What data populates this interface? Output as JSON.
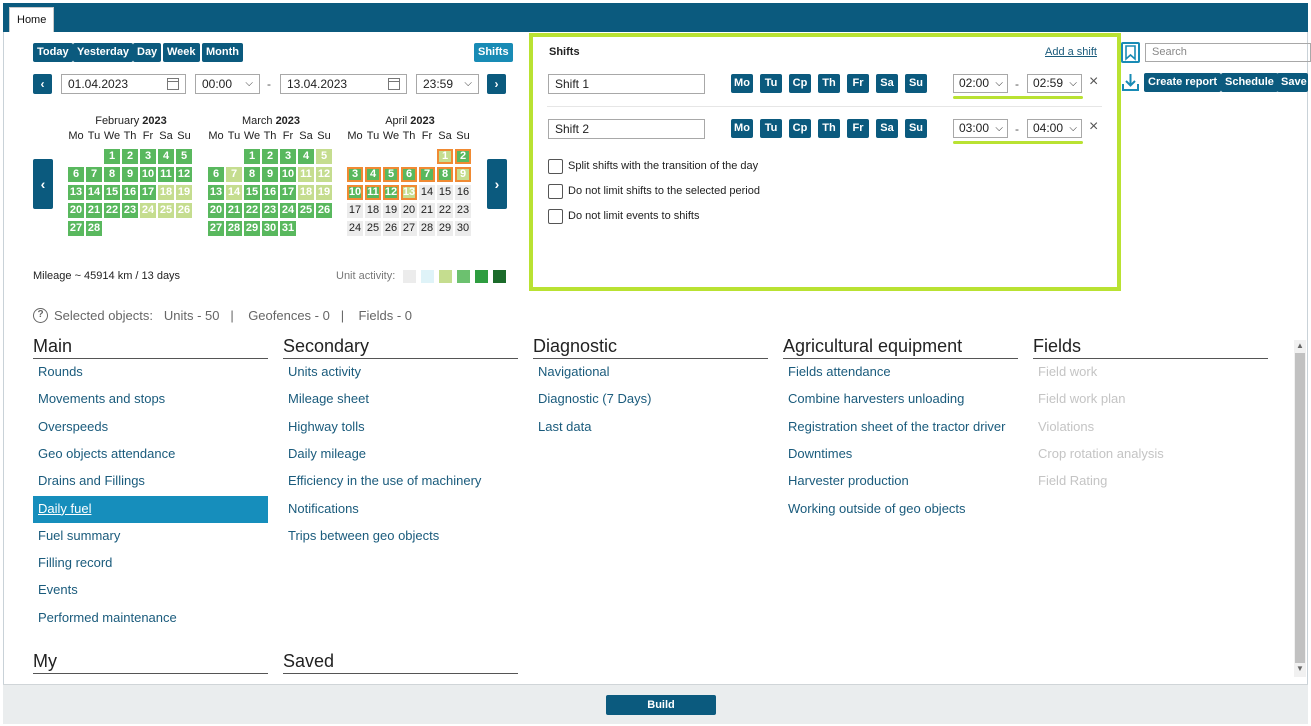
{
  "tabs": {
    "home": "Home"
  },
  "period_buttons": {
    "today": "Today",
    "yesterday": "Yesterday",
    "day": "Day",
    "week": "Week",
    "month": "Month",
    "shifts": "Shifts"
  },
  "date_range": {
    "from_date": "01.04.2023",
    "from_time": "00:00",
    "dash": "-",
    "to_date": "13.04.2023",
    "to_time": "23:59"
  },
  "calendar": {
    "weekdays": [
      "Mo",
      "Tu",
      "We",
      "Th",
      "Fr",
      "Sa",
      "Su"
    ],
    "months": [
      {
        "name": "February",
        "year": "2023"
      },
      {
        "name": "March",
        "year": "2023"
      },
      {
        "name": "April",
        "year": "2023"
      }
    ]
  },
  "stats": {
    "mileage": "Mileage ~ 45914 km / 13 days",
    "unit_activity": "Unit activity:"
  },
  "activity_colors": [
    "#ececec",
    "#dff3f8",
    "#c5dd8f",
    "#6cc16f",
    "#2e9d40",
    "#1b6b2a"
  ],
  "selected_objects": {
    "label": "Selected objects:",
    "units": "Units - 50",
    "geofences": "Geofences - 0",
    "fields": "Fields - 0",
    "divider": "|"
  },
  "shifts": {
    "title": "Shifts",
    "add_link": "Add a shift",
    "rows": [
      {
        "name": "Shift 1",
        "start": "02:00",
        "end": "02:59"
      },
      {
        "name": "Shift 2",
        "start": "03:00",
        "end": "04:00"
      }
    ],
    "days": [
      "Mo",
      "Tu",
      "Cp",
      "Th",
      "Fr",
      "Sa",
      "Su"
    ],
    "dash": "-",
    "close": "×",
    "options": [
      "Split shifts with the transition of the day",
      "Do not limit shifts to the selected period",
      "Do not limit events to shifts"
    ]
  },
  "toolbar_right": {
    "search_placeholder": "Search",
    "create_report": "Create report",
    "schedule": "Schedule",
    "save": "Save"
  },
  "columns": {
    "main": {
      "title": "Main",
      "items": [
        "Rounds",
        "Movements and stops",
        "Overspeeds",
        "Geo objects attendance",
        "Drains and Fillings",
        "Daily fuel",
        "Fuel summary",
        "Filling record",
        "Events",
        "Performed maintenance"
      ]
    },
    "secondary": {
      "title": "Secondary",
      "items": [
        "Units activity",
        "Mileage sheet",
        "Highway tolls",
        "Daily mileage",
        "Efficiency in the use of machinery",
        "Notifications",
        "Trips between geo objects"
      ]
    },
    "diagnostic": {
      "title": "Diagnostic",
      "items": [
        "Navigational",
        "Diagnostic (7 Days)",
        "Last data"
      ]
    },
    "agri": {
      "title": "Agricultural equipment",
      "items": [
        "Fields attendance",
        "Combine harvesters unloading",
        "Registration sheet of the tractor driver",
        "Downtimes",
        "Harvester production",
        "Working outside of geo objects"
      ]
    },
    "fields": {
      "title": "Fields",
      "items": [
        "Field work",
        "Field work plan",
        "Violations",
        "Crop rotation analysis",
        "Field Rating"
      ]
    },
    "my": {
      "title": "My"
    },
    "saved": {
      "title": "Saved"
    }
  },
  "build_button": "Build",
  "colors": {
    "primary": "#0b5a7e",
    "accent_green": "#b9e232",
    "active_item": "#168ebc",
    "calendar_green": "#59b85e",
    "calendar_light": "#c5dd8f",
    "selection_orange": "#f08a33"
  }
}
